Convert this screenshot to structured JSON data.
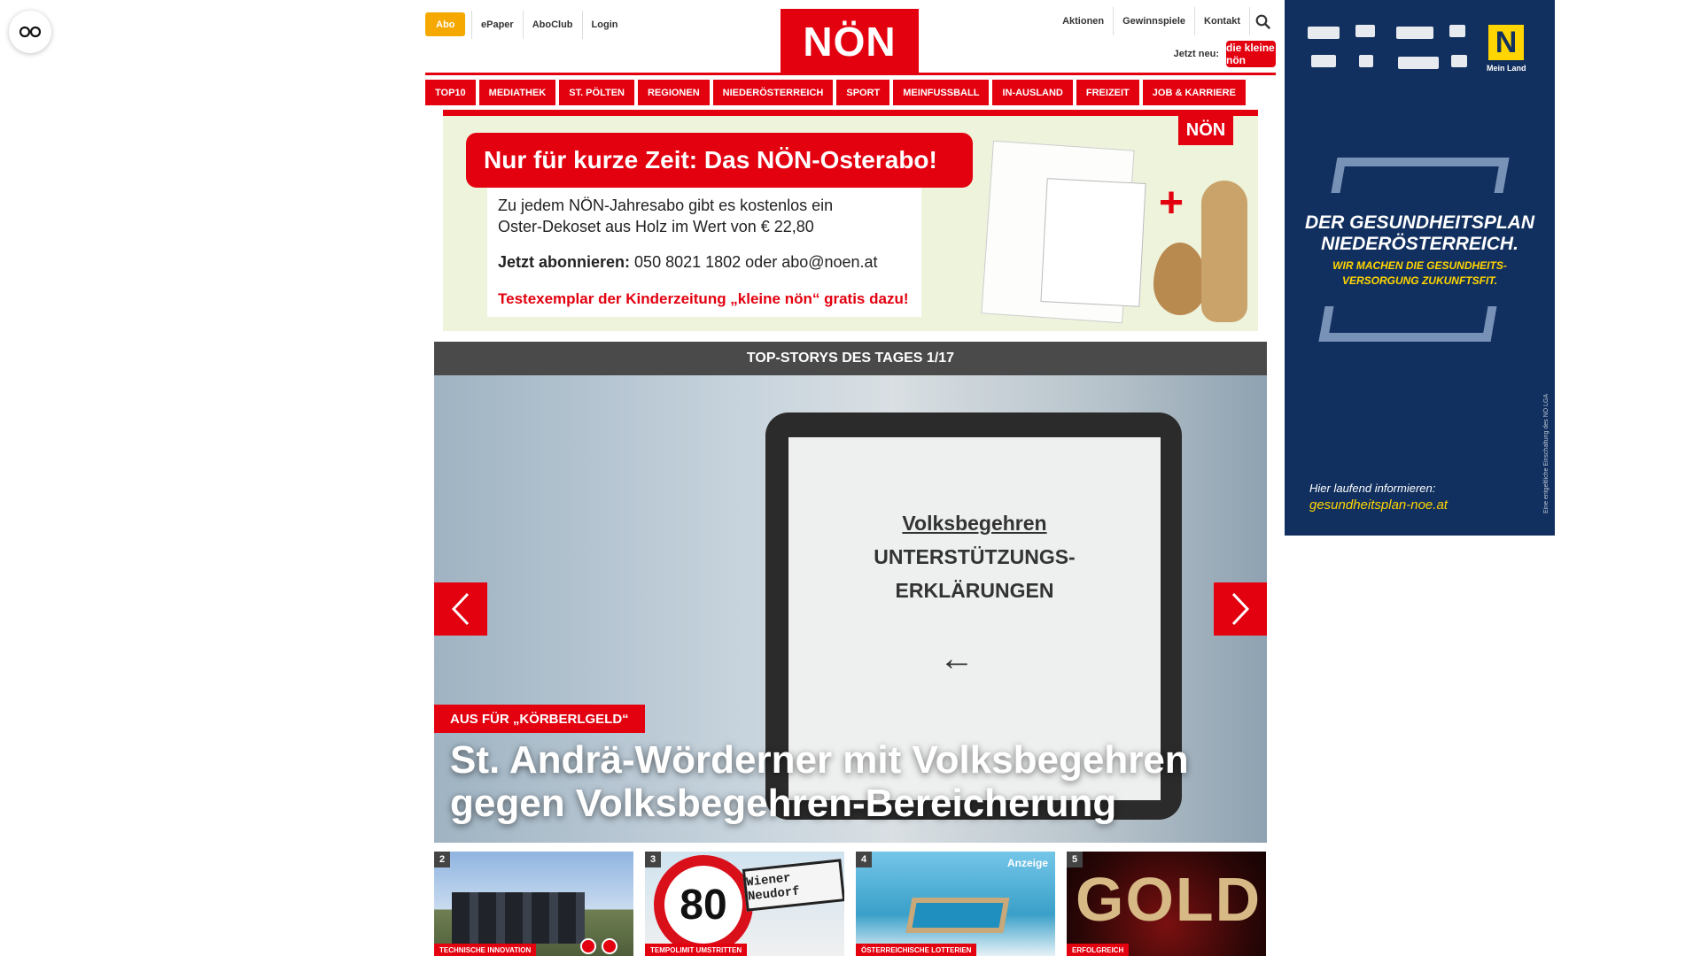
{
  "accessibility": {
    "icon": "glasses-icon"
  },
  "header": {
    "abo_label": "Abo",
    "left_links": [
      "ePaper",
      "AboClub",
      "Login"
    ],
    "logo_text": "NÖN",
    "right_links": [
      "Aktionen",
      "Gewinnspiele",
      "Kontakt"
    ],
    "search_icon": "search-icon",
    "jetzt_neu_label": "Jetzt neu:",
    "kleine_noen_logo": "die kleine nön"
  },
  "nav": {
    "items": [
      "TOP10",
      "MEDIATHEK",
      "ST. PÖLTEN",
      "REGIONEN",
      "NIEDERÖSTERREICH",
      "SPORT",
      "MEINFUSSBALL",
      "IN-AUSLAND",
      "FREIZEIT",
      "JOB & KARRIERE"
    ]
  },
  "ad_banner": {
    "headline": "Nur für kurze Zeit: Das NÖN-Osterabo!",
    "text": "Zu jedem NÖN-Jahresabo gibt es kostenlos ein Oster-Dekoset aus Holz im Wert von € 22,80",
    "cta_label": "Jetzt abonnieren:",
    "cta_contact": "050 8021 1802 oder abo@noen.at",
    "footer": "Testexemplar der Kinderzeitung „kleine nön“ gratis dazu!",
    "logo_text": "NÖN",
    "plus_sign": "+"
  },
  "carousel": {
    "header": "TOP-STORYS DES TAGES 1/17",
    "sign_title": "Volksbegehren",
    "sign_line1": "UNTERSTÜTZUNGS-",
    "sign_line2": "ERKLÄRUNGEN",
    "sign_arrow": "←",
    "kicker": "AUS FÜR „KÖRBERLGELD“",
    "headline": "St. Andrä-Wörderner mit Volksbegehren gegen Volksbegehren-Bereicherung",
    "prev_icon": "chevron-left-icon",
    "next_icon": "chevron-right-icon"
  },
  "thumbs": [
    {
      "num": "2",
      "tag": "TECHNISCHE INNOVATION"
    },
    {
      "num": "3",
      "tag": "TEMPOLIMIT UMSTRITTEN",
      "sign_speed": "80",
      "town": "Wiener Neudorf"
    },
    {
      "num": "4",
      "tag": "ÖSTERREICHISCHE LOTTERIEN",
      "badge": "Anzeige"
    },
    {
      "num": "5",
      "tag": "ERFOLGREICH",
      "word": "GOLD"
    }
  ],
  "side_ad": {
    "title": "DER GESUNDHEITSPLAN NIEDERÖSTERREICH.",
    "subtitle": "WIR MACHEN DIE GESUNDHEITS- VERSORGUNG ZUKUNFTSFIT.",
    "info": "Hier laufend informieren:",
    "url": "gesundheitsplan-noe.at",
    "logo_n": "N",
    "mein_land": "Mein Land",
    "note": "Eine entgeltliche Einschaltung des NÖ LGA"
  },
  "colors": {
    "brand_red": "#e3000f",
    "abo_orange": "#f5a800",
    "side_ad_navy": "#12305f",
    "side_ad_yellow": "#ffd500"
  }
}
